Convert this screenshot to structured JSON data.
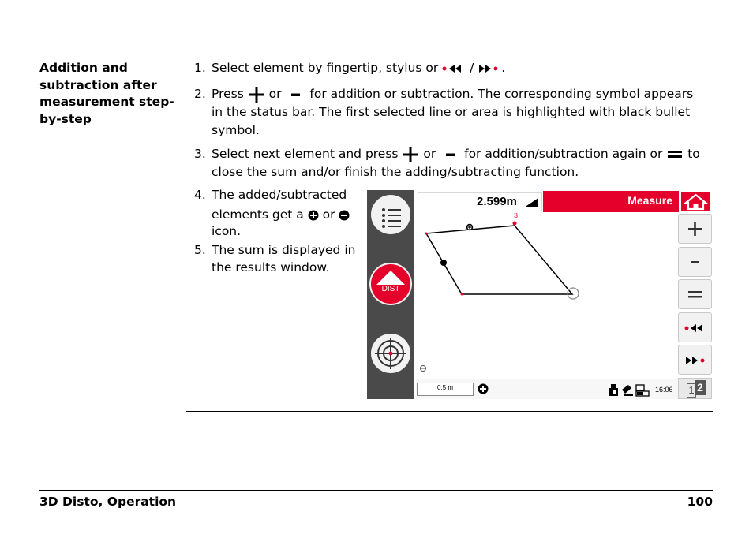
{
  "heading": "Addition and subtraction after measurement step-by-step",
  "steps": {
    "s1": {
      "num": "1.",
      "a": "Select element by fingertip, stylus or",
      "b": "/",
      "c": "."
    },
    "s2": {
      "num": "2.",
      "a": "Press",
      "b": "or",
      "c": "for addition or subtraction. The corresponding symbol appears",
      "d": "in the status bar. The first selected line or area is highlighted with black bullet",
      "e": "symbol."
    },
    "s3": {
      "num": "3.",
      "a": "Select next element and press",
      "b": "or",
      "c": "for addition/subtraction again or",
      "d": "to",
      "e": "close the sum and/or finish the adding/subtracting function."
    },
    "s4": {
      "num": "4.",
      "a": "The added/subtracted",
      "b": "elements get a",
      "c": "or",
      "d": "icon."
    },
    "s5": {
      "num": "5.",
      "a": "The sum is displayed in",
      "b": "the results window."
    }
  },
  "device": {
    "result_value": "2.599m",
    "mode_title": "Measure",
    "dist_label": "DIST",
    "point_label": "3",
    "scale_label": "0.5 m",
    "time": "16:06",
    "page_indicator": {
      "left": "1",
      "right": "2"
    },
    "accent_color": "#e4002b"
  },
  "footer": {
    "left": "3D Disto, Operation",
    "right": "100"
  }
}
